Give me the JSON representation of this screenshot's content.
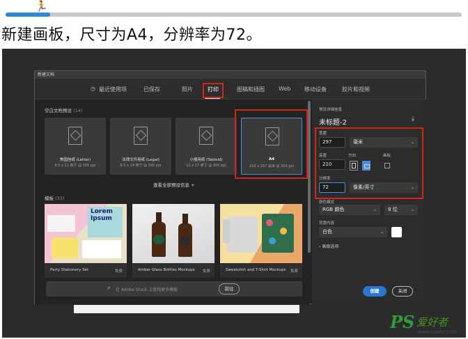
{
  "caption": "新建画板，尺寸为A4，分辨率为72。",
  "dialog": {
    "title": "新建文档",
    "tabs": [
      {
        "label": "最近使用项",
        "active": false
      },
      {
        "label": "已保存",
        "active": false
      },
      {
        "label": "照片",
        "active": false
      },
      {
        "label": "打印",
        "active": true
      },
      {
        "label": "图稿和插图",
        "active": false
      },
      {
        "label": "Web",
        "active": false
      },
      {
        "label": "移动设备",
        "active": false
      },
      {
        "label": "胶片和视频",
        "active": false
      }
    ],
    "presets_title": "空白文档预设",
    "presets_count": "(14)",
    "presets": [
      {
        "name": "美国信纸 (Letter)",
        "size": "8.5 x 11 英寸 @ 300 ppi",
        "selected": false
      },
      {
        "name": "法律文件用纸 (Legal)",
        "size": "8.5 x 14 英寸 @ 300 ppi",
        "selected": false
      },
      {
        "name": "小报用纸 (Tabloid)",
        "size": "11 x 17 英寸 @ 300 ppi",
        "selected": false
      },
      {
        "name": "A4",
        "size": "210 x 297 毫米 @ 300 ppi",
        "selected": true
      }
    ],
    "view_all": "查看全部预设信息 +",
    "templates_title": "模板",
    "templates_count": "(33)",
    "templates": [
      {
        "name": "Party Stationery Set",
        "price": "免费",
        "thumb_text": "Lorem Ipsum"
      },
      {
        "name": "Amber Glass Bottles Mockups",
        "price": "免费"
      },
      {
        "name": "Sweatshirt and T-Shirt Mockups",
        "price": "免费"
      }
    ],
    "search": {
      "placeholder": "在 Adobe Stock 上查找更多模板",
      "button": "前往"
    },
    "details": {
      "section_title": "预设详细信息",
      "doc_name": "未标题-2",
      "width_label": "宽度",
      "width_value": "297",
      "width_unit": "毫米",
      "height_label": "高度",
      "height_value": "210",
      "orientation_label": "方向",
      "artboard_label": "画板",
      "resolution_label": "分辨率",
      "resolution_value": "72",
      "resolution_unit": "像素/英寸",
      "color_mode_label": "颜色模式",
      "color_mode_value": "RGB 颜色",
      "bit_depth": "8 位",
      "bg_label": "背景内容",
      "bg_value": "白色",
      "advanced": "高级选项"
    },
    "buttons": {
      "create": "创建",
      "close": "关闭"
    }
  },
  "watermark": {
    "logo": "PS",
    "text": "爱好者",
    "url": "www.psahz.com"
  },
  "colors": {
    "accent": "#2a76d2",
    "highlight": "#d5261c",
    "dialog_bg": "#232323"
  }
}
